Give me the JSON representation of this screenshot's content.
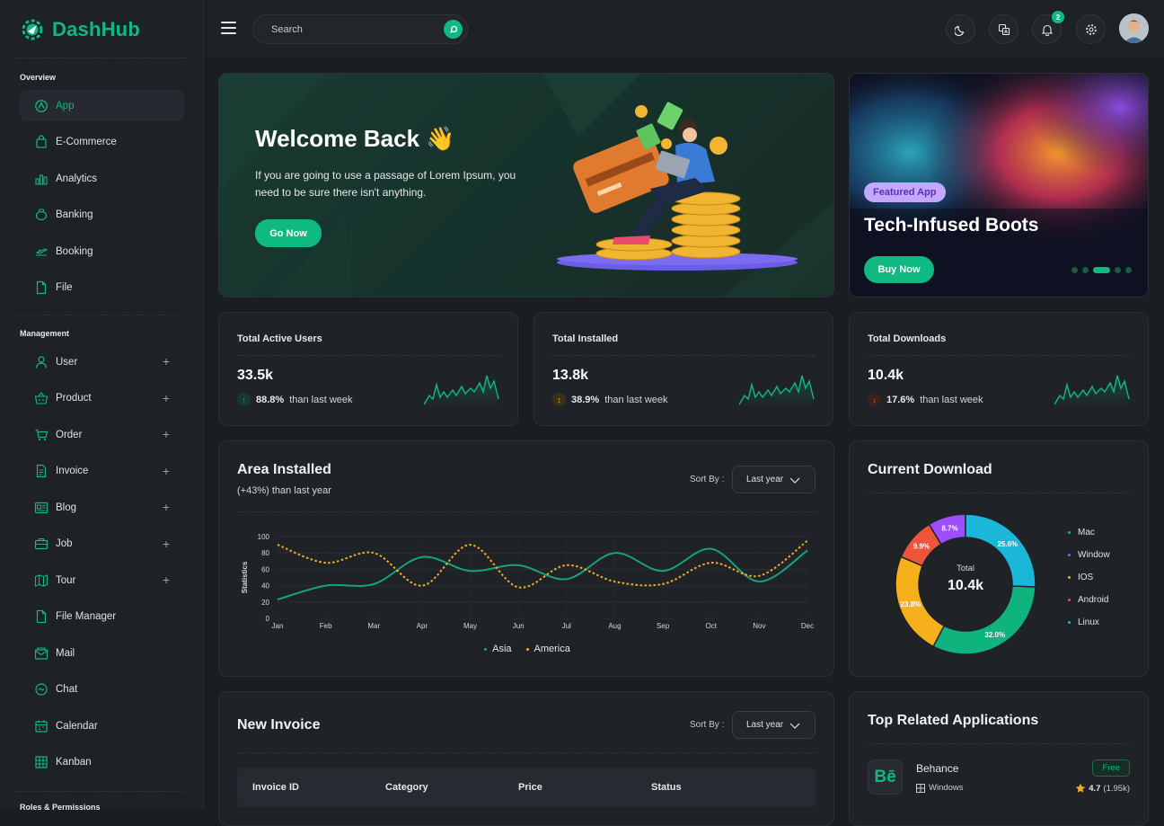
{
  "brand": {
    "name": "DashHub"
  },
  "sidebar": {
    "overview_title": "Overview",
    "overview_items": [
      {
        "label": "App",
        "icon": "app-icon"
      },
      {
        "label": "E-Commerce",
        "icon": "bag-icon"
      },
      {
        "label": "Analytics",
        "icon": "analytics-icon"
      },
      {
        "label": "Banking",
        "icon": "banking-icon"
      },
      {
        "label": "Booking",
        "icon": "plane-icon"
      },
      {
        "label": "File",
        "icon": "file-icon"
      }
    ],
    "management_title": "Management",
    "management_items": [
      {
        "label": "User",
        "icon": "user-icon"
      },
      {
        "label": "Product",
        "icon": "basket-icon"
      },
      {
        "label": "Order",
        "icon": "cart-icon"
      },
      {
        "label": "Invoice",
        "icon": "invoice-icon"
      },
      {
        "label": "Blog",
        "icon": "blog-icon"
      },
      {
        "label": "Job",
        "icon": "briefcase-icon"
      },
      {
        "label": "Tour",
        "icon": "map-icon"
      },
      {
        "label": "File Manager",
        "icon": "folder-icon"
      },
      {
        "label": "Mail",
        "icon": "mail-icon"
      },
      {
        "label": "Chat",
        "icon": "chat-icon"
      },
      {
        "label": "Calendar",
        "icon": "calendar-icon"
      },
      {
        "label": "Kanban",
        "icon": "kanban-icon"
      }
    ],
    "roles_title": "Roles & Permissions"
  },
  "topbar": {
    "search_placeholder": "Search",
    "notification_count": "2"
  },
  "welcome": {
    "title": "Welcome Back 👋",
    "text": "If you are going to use a passage of Lorem Ipsum, you need to be sure there isn't anything.",
    "button": "Go Now"
  },
  "featured": {
    "tag": "Featured App",
    "title": "Tech-Infused Boots",
    "button": "Buy Now"
  },
  "stats": [
    {
      "title": "Total Active Users",
      "value": "33.5k",
      "percent": "88.8%",
      "suffix": "than last week",
      "trend": "up"
    },
    {
      "title": "Total Installed",
      "value": "13.8k",
      "percent": "38.9%",
      "suffix": "than last week",
      "trend": "both"
    },
    {
      "title": "Total Downloads",
      "value": "10.4k",
      "percent": "17.6%",
      "suffix": "than last week",
      "trend": "down"
    }
  ],
  "area": {
    "title": "Area Installed",
    "subtitle": "(+43%) than last year",
    "sort_label": "Sort By :",
    "sort_value": "Last year"
  },
  "download": {
    "title": "Current Download",
    "center_label": "Total",
    "center_value": "10.4k"
  },
  "invoice": {
    "title": "New Invoice",
    "sort_label": "Sort By :",
    "sort_value": "Last year",
    "columns": [
      "Invoice ID",
      "Category",
      "Price",
      "Status"
    ]
  },
  "apps": {
    "title": "Top Related Applications",
    "items": [
      {
        "logo": "Bē",
        "name": "Behance",
        "os": "Windows",
        "price": "Free",
        "rating": "4.7",
        "reviews": "(1.95k)"
      }
    ]
  },
  "colors": {
    "accent": "#10b981",
    "asia": "#16a37a",
    "america": "#f5b01b"
  },
  "chart_data": [
    {
      "type": "line",
      "ylabel": "Statistics",
      "ylim": [
        0,
        100
      ],
      "yticks": [
        0,
        20,
        40,
        60,
        80,
        100
      ],
      "categories": [
        "Jan",
        "Feb",
        "Mar",
        "Apr",
        "May",
        "Jun",
        "Jul",
        "Aug",
        "Sep",
        "Oct",
        "Nov",
        "Dec"
      ],
      "series": [
        {
          "name": "Asia",
          "color": "#16a37a",
          "dashed": false,
          "values": [
            23,
            40,
            42,
            75,
            58,
            65,
            48,
            80,
            58,
            85,
            45,
            83
          ]
        },
        {
          "name": "America",
          "color": "#f5b01b",
          "dashed": true,
          "values": [
            90,
            68,
            80,
            40,
            90,
            38,
            65,
            45,
            42,
            68,
            52,
            95
          ]
        }
      ]
    },
    {
      "type": "pie",
      "donut": true,
      "categories": [
        "Mac",
        "Window",
        "IOS",
        "Android",
        "Linux"
      ],
      "values": [
        32.0,
        23.8,
        9.9,
        8.7,
        25.6
      ],
      "labels": [
        "32.0%",
        "23.8%",
        "9.9%",
        "8.7%",
        "25.6%"
      ],
      "colors": [
        "#0fb37e",
        "#f5b01b",
        "#f0533b",
        "#9b4dff",
        "#1bb7d8"
      ],
      "legend": [
        {
          "label": "Mac",
          "color": "#10b981"
        },
        {
          "label": "Window",
          "color": "#9b4dff"
        },
        {
          "label": "IOS",
          "color": "#f5b01b"
        },
        {
          "label": "Android",
          "color": "#f0533b"
        },
        {
          "label": "Linux",
          "color": "#1bb7d8"
        }
      ]
    }
  ]
}
